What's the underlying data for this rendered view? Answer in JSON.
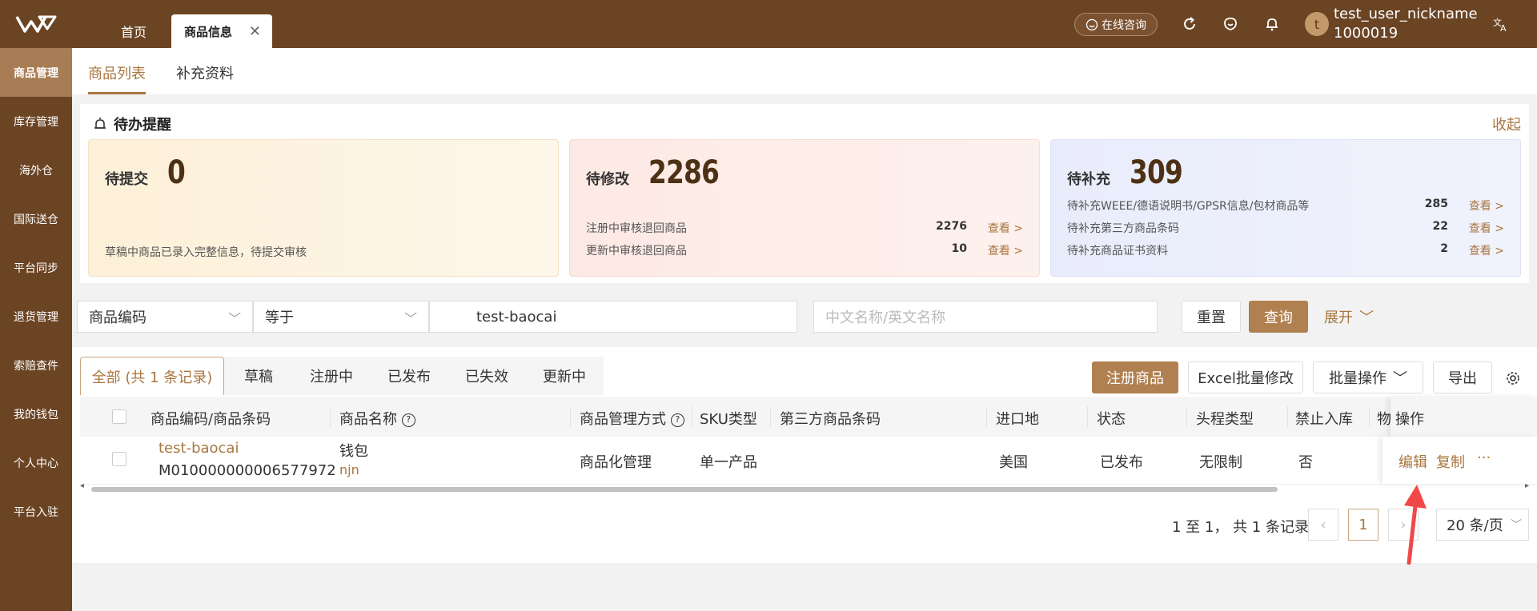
{
  "header": {
    "tabs": [
      {
        "label": "首页"
      },
      {
        "label": "商品信息"
      }
    ],
    "consult_label": "在线咨询",
    "avatar_letter": "t",
    "user_name": "test_user_nickname",
    "user_id": "1000019"
  },
  "sidebar": {
    "items": [
      {
        "label": "商品管理"
      },
      {
        "label": "库存管理"
      },
      {
        "label": "海外仓"
      },
      {
        "label": "国际送仓"
      },
      {
        "label": "平台同步"
      },
      {
        "label": "退货管理"
      },
      {
        "label": "索赔查件"
      },
      {
        "label": "我的钱包"
      },
      {
        "label": "个人中心"
      },
      {
        "label": "平台入驻"
      }
    ]
  },
  "subtabs": [
    {
      "label": "商品列表"
    },
    {
      "label": "补充资料"
    }
  ],
  "todo": {
    "title": "待办提醒",
    "collapse": "收起",
    "cards": [
      {
        "label": "待提交",
        "count": "0",
        "desc": "草稿中商品已录入完整信息，待提交审核"
      },
      {
        "label": "待修改",
        "count": "2286",
        "rows": [
          {
            "text": "注册中审核退回商品",
            "count": "2276",
            "view": "查看 >"
          },
          {
            "text": "更新中审核退回商品",
            "count": "10",
            "view": "查看 >"
          }
        ]
      },
      {
        "label": "待补充",
        "count": "309",
        "rows": [
          {
            "text": "待补充WEEE/德语说明书/GPSR信息/包材商品等",
            "count": "285",
            "view": "查看 >"
          },
          {
            "text": "待补充第三方商品条码",
            "count": "22",
            "view": "查看 >"
          },
          {
            "text": "待补充商品证书资料",
            "count": "2",
            "view": "查看 >"
          }
        ]
      }
    ]
  },
  "filter": {
    "field": "商品编码",
    "operator": "等于",
    "value": "test-baocai",
    "name_placeholder": "中文名称/英文名称",
    "reset": "重置",
    "query": "查询",
    "expand": "展开"
  },
  "status_tabs": [
    {
      "label": "全部 (共 1 条记录)"
    },
    {
      "label": "草稿"
    },
    {
      "label": "注册中"
    },
    {
      "label": "已发布"
    },
    {
      "label": "已失效"
    },
    {
      "label": "更新中"
    }
  ],
  "actions": {
    "register": "注册商品",
    "excel": "Excel批量修改",
    "batch": "批量操作",
    "export": "导出"
  },
  "table": {
    "columns": [
      "商品编码/商品条码",
      "商品名称",
      "商品管理方式",
      "SKU类型",
      "第三方商品条码",
      "进口地",
      "状态",
      "头程类型",
      "禁止入库",
      "物",
      "操作"
    ],
    "rows": [
      {
        "code": "test-baocai",
        "barcode": "M010000000006577972",
        "name": "钱包",
        "name_en": "njn",
        "manage": "商品化管理",
        "sku_type": "单一产品",
        "third_code": "",
        "import": "美国",
        "status": "已发布",
        "first_leg": "无限制",
        "forbid": "否",
        "op_edit": "编辑",
        "op_copy": "复制",
        "op_more": "···"
      }
    ]
  },
  "pagination": {
    "summary": "1 至 1， 共 1 条记录",
    "page": "1",
    "page_size": "20 条/页"
  },
  "colors": {
    "brand": "#6b4424",
    "accent": "#a9763f",
    "button": "#b08050",
    "arrow": "#f04848"
  }
}
